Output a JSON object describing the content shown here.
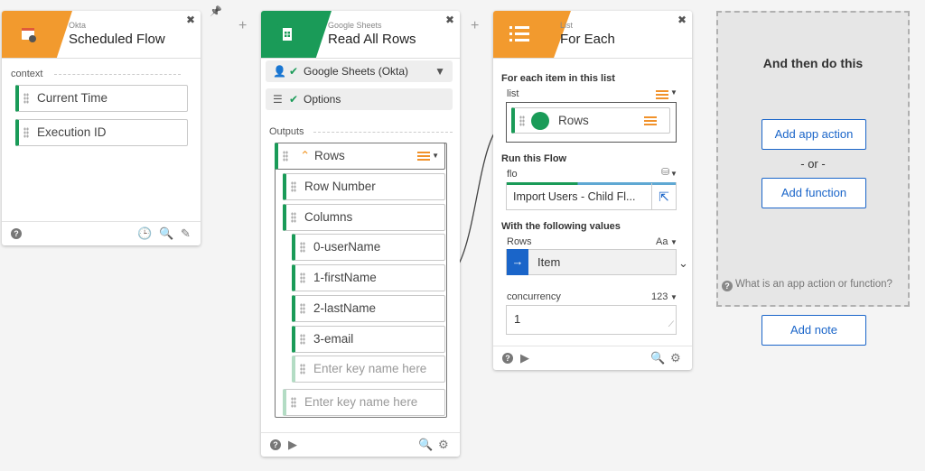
{
  "connector_plus": "+",
  "pin": "📌",
  "card1": {
    "small": "Okta",
    "title": "Scheduled Flow",
    "context_label": "context",
    "fields": [
      "Current Time",
      "Execution ID"
    ]
  },
  "card2": {
    "small": "Google Sheets",
    "title": "Read All Rows",
    "connection": "Google Sheets (Okta)",
    "options": "Options",
    "outputs_label": "Outputs",
    "rows_label": "Rows",
    "row_number": "Row Number",
    "columns": "Columns",
    "column_fields": [
      "0-userName",
      "1-firstName",
      "2-lastName",
      "3-email"
    ],
    "placeholder_inner": "Enter key name here",
    "placeholder_outer": "Enter key name here"
  },
  "card3": {
    "small": "List",
    "title": "For Each",
    "section1": "For each item in this list",
    "list_label": "list",
    "list_value": "Rows",
    "section2": "Run this Flow",
    "flo_label": "flo",
    "flo_value": "Import Users - Child Fl...",
    "section3": "With the following values",
    "rows_label": "Rows",
    "rows_type": "Aa",
    "item_value": "Item",
    "concurrency_label": "concurrency",
    "concurrency_type": "123",
    "concurrency_value": "1"
  },
  "card4": {
    "heading": "And then do this",
    "add_app_action": "Add app action",
    "or": "- or -",
    "add_function": "Add function",
    "help": "What is an app action or function?",
    "add_note": "Add note"
  },
  "colors": {
    "okta_orange": "#f29a2e",
    "sheets_green": "#1a9b58",
    "list_orange": "#f29a2e",
    "link_blue": "#1a65c9"
  }
}
